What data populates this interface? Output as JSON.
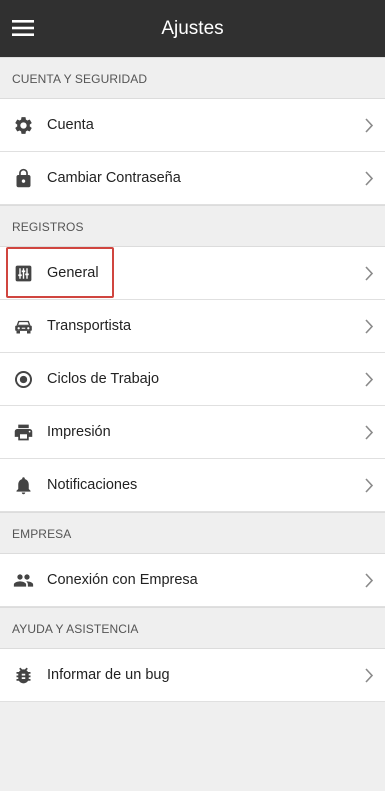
{
  "header": {
    "title": "Ajustes",
    "menu_icon": "hamburger-menu-icon"
  },
  "sections": {
    "account": {
      "title": "CUENTA Y SEGURIDAD",
      "items": [
        {
          "label": "Cuenta",
          "icon": "gear-icon"
        },
        {
          "label": "Cambiar Contraseña",
          "icon": "lock-icon"
        }
      ]
    },
    "records": {
      "title": "REGISTROS",
      "items": [
        {
          "label": "General",
          "icon": "tune-sliders-icon"
        },
        {
          "label": "Transportista",
          "icon": "car-icon"
        },
        {
          "label": "Ciclos de Trabajo",
          "icon": "radio-button-icon"
        },
        {
          "label": "Impresión",
          "icon": "printer-icon"
        },
        {
          "label": "Notificaciones",
          "icon": "bell-icon"
        }
      ]
    },
    "company": {
      "title": "EMPRESA",
      "items": [
        {
          "label": "Conexión con Empresa",
          "icon": "people-icon"
        }
      ]
    },
    "help": {
      "title": "AYUDA Y ASISTENCIA",
      "items": [
        {
          "label": "Informar de un bug",
          "icon": "bug-icon"
        }
      ]
    }
  },
  "colors": {
    "topbar": "#303030",
    "background": "#efefef",
    "row": "#ffffff",
    "icon": "#444444",
    "highlight": "#d0453f"
  }
}
